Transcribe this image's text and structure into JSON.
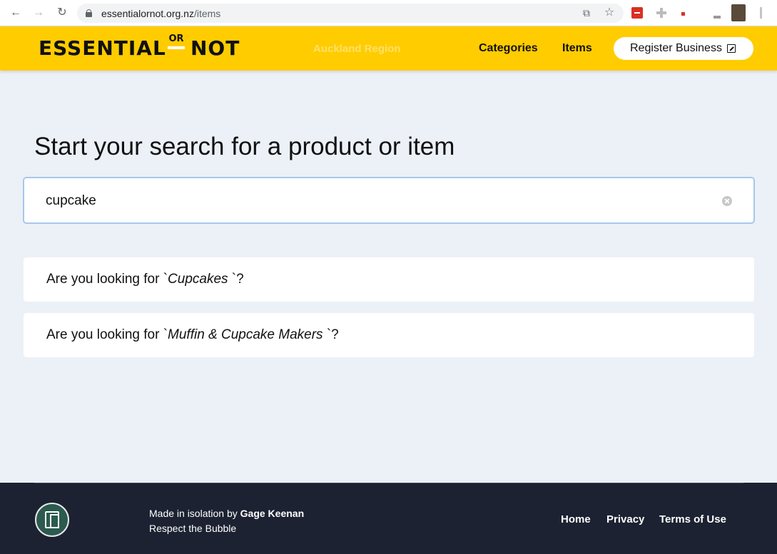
{
  "browser": {
    "url_host": "essentialornot.org.nz",
    "url_path": "/items",
    "back_icon": "arrow-left-icon",
    "forward_icon": "arrow-right-icon",
    "reload_icon": "reload-icon",
    "back_glyph": "←",
    "forward_glyph": "→",
    "reload_glyph": "↻",
    "open_app_glyph": "⧉",
    "star_glyph": "☆"
  },
  "header": {
    "logo_left": "ESSENTIAL",
    "logo_or": "OR",
    "logo_right": "NOT",
    "region": "Auckland Region",
    "nav": {
      "categories": "Categories",
      "items": "Items"
    },
    "register_label": "Register Business",
    "accent_color": "#ffcc00"
  },
  "main": {
    "title": "Start your search for a product or item",
    "search": {
      "value": "cupcake"
    },
    "suggestions": [
      {
        "prefix": "Are you looking for  `",
        "term": "Cupcakes",
        "suffix": " `?"
      },
      {
        "prefix": "Are you looking for  `",
        "term": "Muffin & Cupcake Makers",
        "suffix": " `?"
      }
    ]
  },
  "footer": {
    "made_prefix": "Made in isolation by ",
    "author": "Gage Keenan",
    "tagline": "Respect the Bubble",
    "links": {
      "home": "Home",
      "privacy": "Privacy",
      "terms": "Terms of Use"
    },
    "background_color": "#1c2231"
  }
}
